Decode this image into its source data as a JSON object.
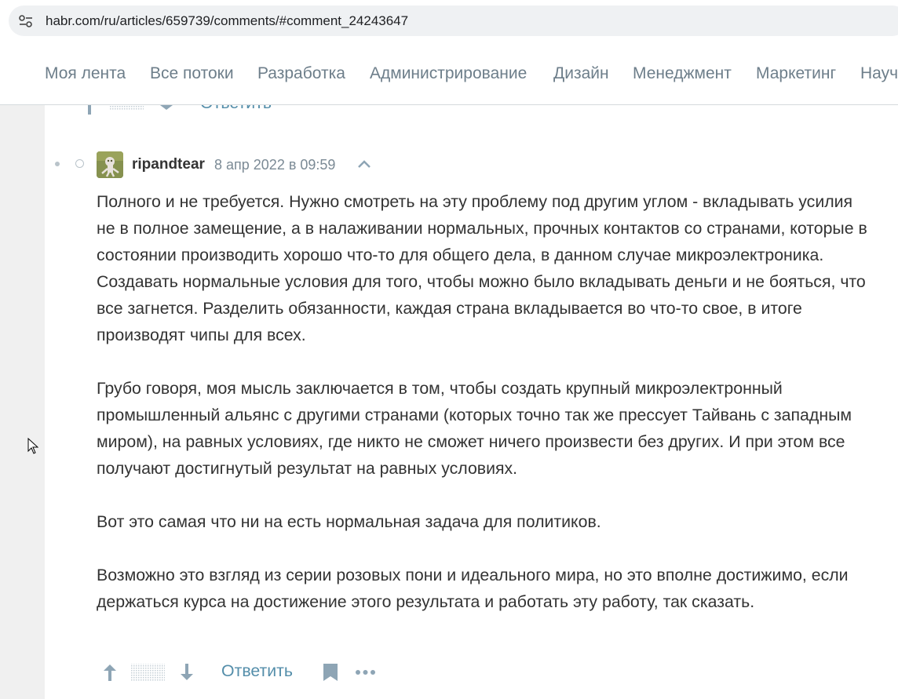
{
  "browser": {
    "url": "habr.com/ru/articles/659739/comments/#comment_24243647"
  },
  "nav": {
    "items": [
      "Моя лента",
      "Все потоки",
      "Разработка",
      "Администрирование",
      "Дизайн",
      "Менеджмент",
      "Маркетинг",
      "Науч"
    ]
  },
  "prev_comment": {
    "reply_label": "Ответить"
  },
  "comment": {
    "author": "ripandtear",
    "date": "8 апр 2022 в 09:59",
    "paragraphs": [
      "Полного и не требуется. Нужно смотреть на эту проблему под другим углом - вкладывать усилия не в полное замещение, а в налаживании нормальных, прочных контактов со странами, которые в состоянии производить хорошо что-то для общего дела, в данном случае микроэлектроника. Создавать нормальные условия для того, чтобы можно было вкладывать деньги и не бояться, что все загнется. Разделить обязанности, каждая страна вкладывается во что-то свое, в итоге производят чипы для всех.",
      "Грубо говоря, моя мысль заключается в том, чтобы создать крупный микроэлектронный промышленный альянс с другими странами (которых точно так же прессует Тайвань с западным миром), на равных условиях, где никто не сможет ничего произвести без других. И при этом все получают достигнутый результат на равных условиях.",
      "Вот это самая что ни на есть нормальная задача для политиков.",
      "Возможно это взгляд из серии розовых пони и идеального мира, но это вполне достижимо, если держаться курса на достижение этого результата и работать эту работу, так сказать."
    ],
    "reply_label": "Ответить"
  },
  "colors": {
    "link": "#548eaa",
    "nav_text": "#6d7e8a",
    "muted": "#7b8a95",
    "icon": "#8ea5b5"
  }
}
